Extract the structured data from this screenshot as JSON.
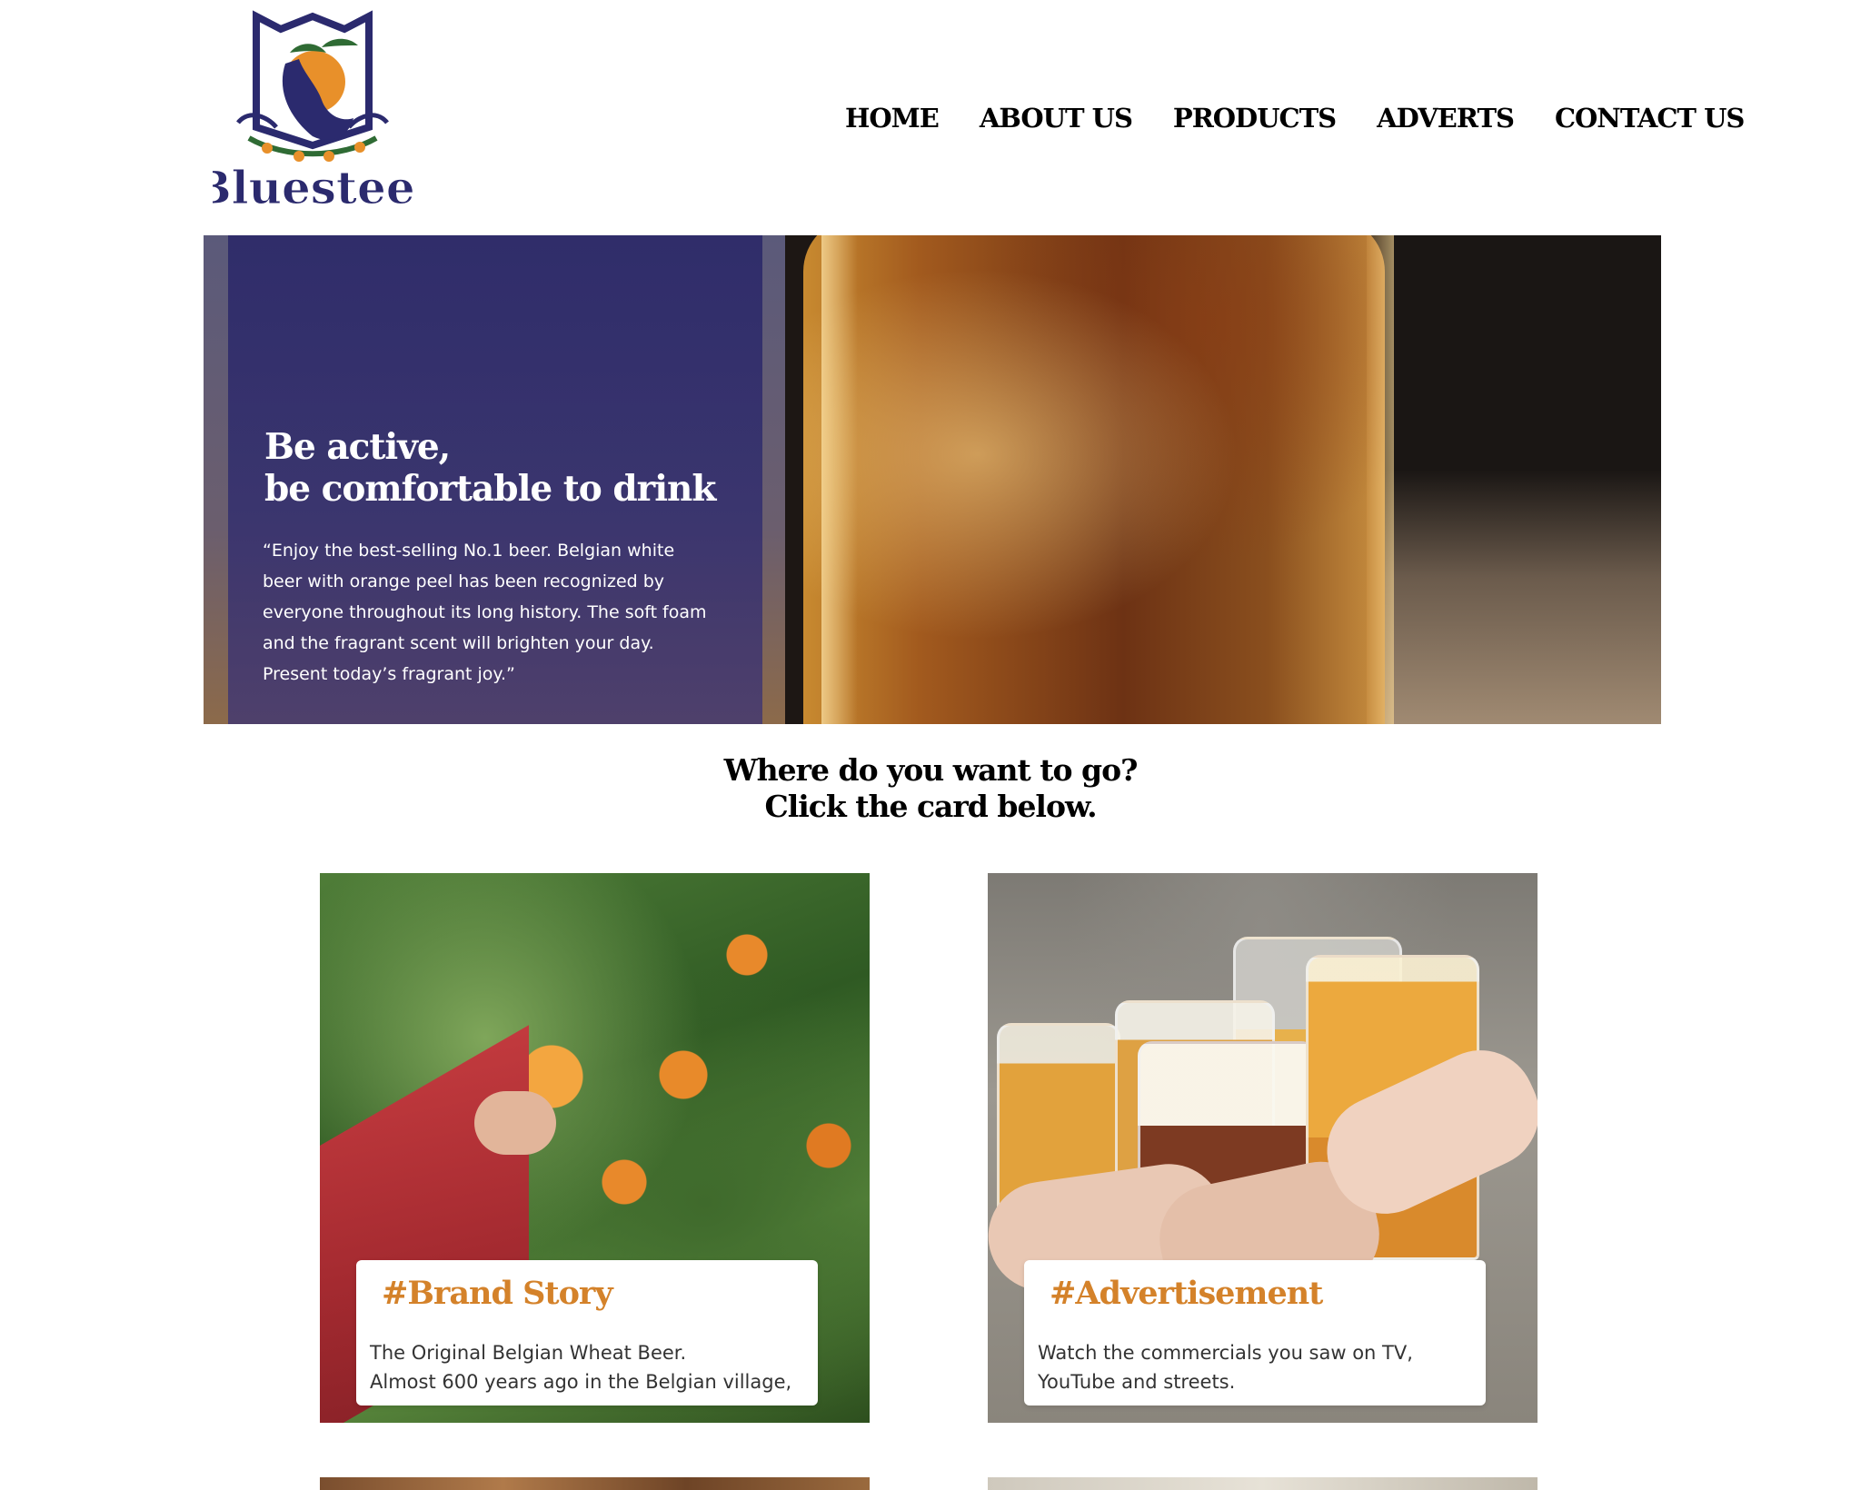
{
  "brand": {
    "name": "Bluesteel",
    "colors": {
      "navy": "#2b2a6e",
      "orange": "#e68a26",
      "accent": "#d4822a"
    }
  },
  "nav": {
    "items": [
      {
        "label": "HOME"
      },
      {
        "label": "ABOUT US"
      },
      {
        "label": "PRODUCTS"
      },
      {
        "label": "ADVERTS"
      },
      {
        "label": "CONTACT US"
      }
    ]
  },
  "hero": {
    "title_line1": "Be active,",
    "title_line2": "be comfortable to drink",
    "body": "“Enjoy the best-selling No.1 beer. Belgian white beer with orange peel has been recognized by everyone throughout its long history. The soft foam and the fragrant scent will brighten your day. Present today’s fragrant joy.”"
  },
  "section": {
    "line1": "Where do you want to go?",
    "line2": "Click the card below."
  },
  "cards": [
    {
      "title": "#Brand Story",
      "line1": "The Original Belgian Wheat Beer.",
      "line2": "Almost 600 years ago in the Belgian village,"
    },
    {
      "title": "#Advertisement",
      "line1": "Watch the commercials you saw on TV,",
      "line2": "YouTube and streets."
    }
  ]
}
